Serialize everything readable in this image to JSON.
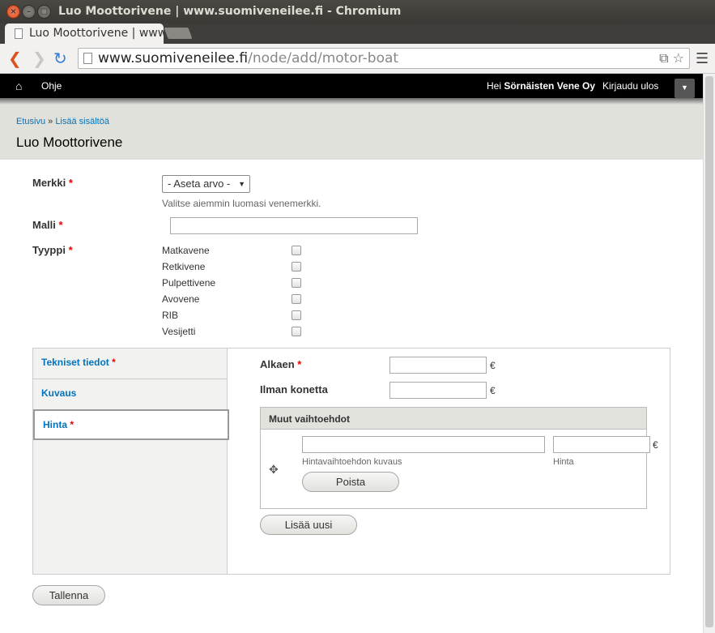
{
  "window": {
    "title": "Luo Moottorivene | www.suomiveneilee.fi - Chromium"
  },
  "tab": {
    "title": "Luo Moottorivene | www.suomiveneilee.fi"
  },
  "address": {
    "host": "www.suomiveneilee.fi",
    "path": "/node/add/motor-boat"
  },
  "adminbar": {
    "ohje": "Ohje",
    "hei": "Hei ",
    "user": "Sörnäisten Vene Oy",
    "logout": "Kirjaudu ulos"
  },
  "breadcrumb": {
    "home": "Etusivu",
    "sep": " » ",
    "add": "Lisää sisältöä"
  },
  "page_title": "Luo Moottorivene",
  "form": {
    "merkki": {
      "label": "Merkki",
      "select_value": "- Aseta arvo -",
      "description": "Valitse aiemmin luomasi venemerkki."
    },
    "malli": {
      "label": "Malli",
      "value": ""
    },
    "tyyppi": {
      "label": "Tyyppi",
      "options": [
        "Matkavene",
        "Retkivene",
        "Pulpettivene",
        "Avovene",
        "RIB",
        "Vesijetti"
      ]
    },
    "required_mark": "*",
    "vtabs": [
      "Tekniset tiedot",
      "Kuvaus",
      "Hinta"
    ],
    "hinta": {
      "alkaen": "Alkaen",
      "ilman": "Ilman konetta",
      "currency": "€",
      "fieldset_title": "Muut vaihtoehdot",
      "desc_label": "Hintavaihtoehdon kuvaus",
      "price_label": "Hinta",
      "remove": "Poista",
      "add_new": "Lisää uusi"
    },
    "save": "Tallenna"
  }
}
